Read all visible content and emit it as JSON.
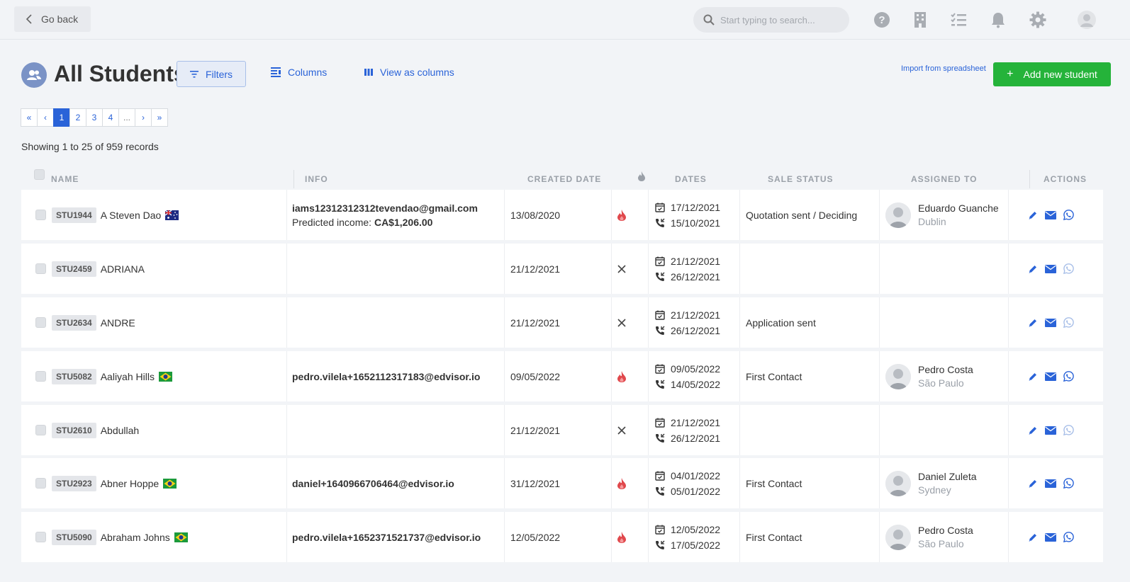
{
  "header": {
    "back_label": "Go back",
    "search_placeholder": "Start typing to search...",
    "icons": [
      "help-icon",
      "building-icon",
      "tasks-icon",
      "bell-icon",
      "gear-icon",
      "user-avatar-icon"
    ]
  },
  "page": {
    "title": "All Students",
    "filters_label": "Filters",
    "columns_label": "Columns",
    "view_as_columns_label": "View as columns",
    "import_label": "Import from spreadsheet",
    "add_label": "Add new student",
    "records_text": "Showing 1 to 25 of 959 records"
  },
  "pagination": {
    "items": [
      "«",
      "‹",
      "1",
      "2",
      "3",
      "4",
      "...",
      "›",
      "»"
    ],
    "active": "1"
  },
  "table": {
    "columns": {
      "name": "NAME",
      "info": "INFO",
      "created": "CREATED DATE",
      "dates": "DATES",
      "sale_status": "SALE STATUS",
      "assigned": "ASSIGNED TO",
      "actions": "ACTIONS"
    },
    "rows": [
      {
        "id": "STU1944",
        "name": "A Steven Dao",
        "flag": "au",
        "email": "iams12312312312tevendao@gmail.com",
        "income_label": "Predicted income:",
        "income": "CA$1,206.00",
        "created": "13/08/2020",
        "hot": true,
        "date1": "17/12/2021",
        "date2": "15/10/2021",
        "status": "Quotation sent / Deciding",
        "agent": "Eduardo Guanche",
        "city": "Dublin",
        "whatsapp": true
      },
      {
        "id": "STU2459",
        "name": "ADRIANA",
        "flag": "",
        "email": "",
        "income_label": "",
        "income": "",
        "created": "21/12/2021",
        "hot": false,
        "date1": "21/12/2021",
        "date2": "26/12/2021",
        "status": "",
        "agent": "",
        "city": "",
        "whatsapp": false
      },
      {
        "id": "STU2634",
        "name": "ANDRE",
        "flag": "",
        "email": "",
        "income_label": "",
        "income": "",
        "created": "21/12/2021",
        "hot": false,
        "date1": "21/12/2021",
        "date2": "26/12/2021",
        "status": "Application sent",
        "agent": "",
        "city": "",
        "whatsapp": false
      },
      {
        "id": "STU5082",
        "name": "Aaliyah Hills",
        "flag": "br",
        "email": "pedro.vilela+1652112317183@edvisor.io",
        "income_label": "",
        "income": "",
        "created": "09/05/2022",
        "hot": true,
        "date1": "09/05/2022",
        "date2": "14/05/2022",
        "status": "First Contact",
        "agent": "Pedro Costa",
        "city": "São Paulo",
        "whatsapp": true
      },
      {
        "id": "STU2610",
        "name": "Abdullah",
        "flag": "",
        "email": "",
        "income_label": "",
        "income": "",
        "created": "21/12/2021",
        "hot": false,
        "date1": "21/12/2021",
        "date2": "26/12/2021",
        "status": "",
        "agent": "",
        "city": "",
        "whatsapp": false
      },
      {
        "id": "STU2923",
        "name": "Abner Hoppe",
        "flag": "br",
        "email": "daniel+1640966706464@edvisor.io",
        "income_label": "",
        "income": "",
        "created": "31/12/2021",
        "hot": true,
        "date1": "04/01/2022",
        "date2": "05/01/2022",
        "status": "First Contact",
        "agent": "Daniel Zuleta",
        "city": "Sydney",
        "whatsapp": true
      },
      {
        "id": "STU5090",
        "name": "Abraham Johns",
        "flag": "br",
        "email": "pedro.vilela+1652371521737@edvisor.io",
        "income_label": "",
        "income": "",
        "created": "12/05/2022",
        "hot": true,
        "date1": "12/05/2022",
        "date2": "17/05/2022",
        "status": "First Contact",
        "agent": "Pedro Costa",
        "city": "São Paulo",
        "whatsapp": true
      }
    ]
  },
  "colors": {
    "accent": "#2a63d8",
    "add_button": "#25b33a",
    "hot_icon": "#e0484c"
  }
}
